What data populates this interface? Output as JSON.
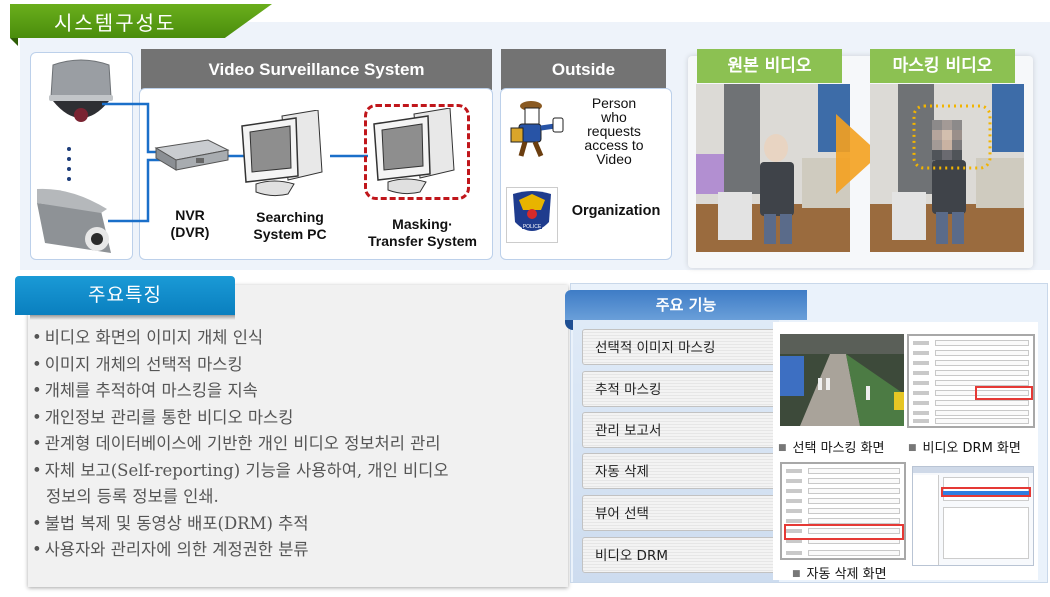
{
  "header": {
    "title": "시스템구성도",
    "accent_color": "#5b9e16"
  },
  "diagram": {
    "video_surveillance_title": "Video Surveillance System",
    "outside_title": "Outside",
    "devices": [
      {
        "icon": "dome-camera-icon",
        "label": ""
      },
      {
        "icon": "bullet-camera-icon",
        "label": ""
      }
    ],
    "components": [
      {
        "id": "nvr",
        "icon": "nvr-recorder-icon",
        "label_lines": [
          "NVR",
          "(DVR)"
        ]
      },
      {
        "id": "searching-pc",
        "icon": "desktop-pc-icon",
        "label_lines": [
          "Searching",
          "System PC"
        ]
      },
      {
        "id": "masking-system",
        "icon": "desktop-pc-icon",
        "label_lines": [
          "Masking·",
          "Transfer System"
        ],
        "highlighted": true
      }
    ],
    "outside_entities": [
      {
        "icon": "requester-person-icon",
        "label_lines": [
          "Person",
          "who",
          "requests",
          "access to",
          "Video"
        ]
      },
      {
        "icon": "police-badge-icon",
        "label": "Organization"
      }
    ],
    "link_color": "#1a6fc9",
    "highlight_color": "#c0161b"
  },
  "video_compare": {
    "original_label": "원본 비디오",
    "masked_label": "마스킹 비디오",
    "arrow_color": "#f4a11f",
    "mask_outline_color": "#f2b400"
  },
  "features": {
    "title": "주요특징",
    "items": [
      {
        "text": "비디오 화면의 이미지 개체 인식"
      },
      {
        "text": "이미지 개체의 선택적 마스킹"
      },
      {
        "text": "개체를 추적하여 마스킹을 지속"
      },
      {
        "text": "개인정보 관리를 통한 비디오 마스킹"
      },
      {
        "text": "관계형 데이터베이스에 기반한 개인 비디오 정보처리 관리"
      },
      {
        "text": "자체 보고(Self-reporting) 기능을 사용하여, 개인 비디오",
        "continuation": "정보의 등록 정보를 인쇄."
      },
      {
        "text": "불법 복제 및 동영상 배포(DRM) 추적"
      },
      {
        "text": "사용자와 관리자에 의한 계정권한 분류"
      }
    ]
  },
  "functions": {
    "title": "주요 기능",
    "buttons": [
      "선택적 이미지 마스킹",
      "추적 마스킹",
      "관리 보고서",
      "자동 삭제",
      "뷰어 선택",
      "비디오 DRM"
    ],
    "screenshots": [
      {
        "caption": "선택 마스킹 화면"
      },
      {
        "caption": "비디오 DRM 화면"
      },
      {
        "caption": "자동 삭제 화면"
      }
    ]
  }
}
